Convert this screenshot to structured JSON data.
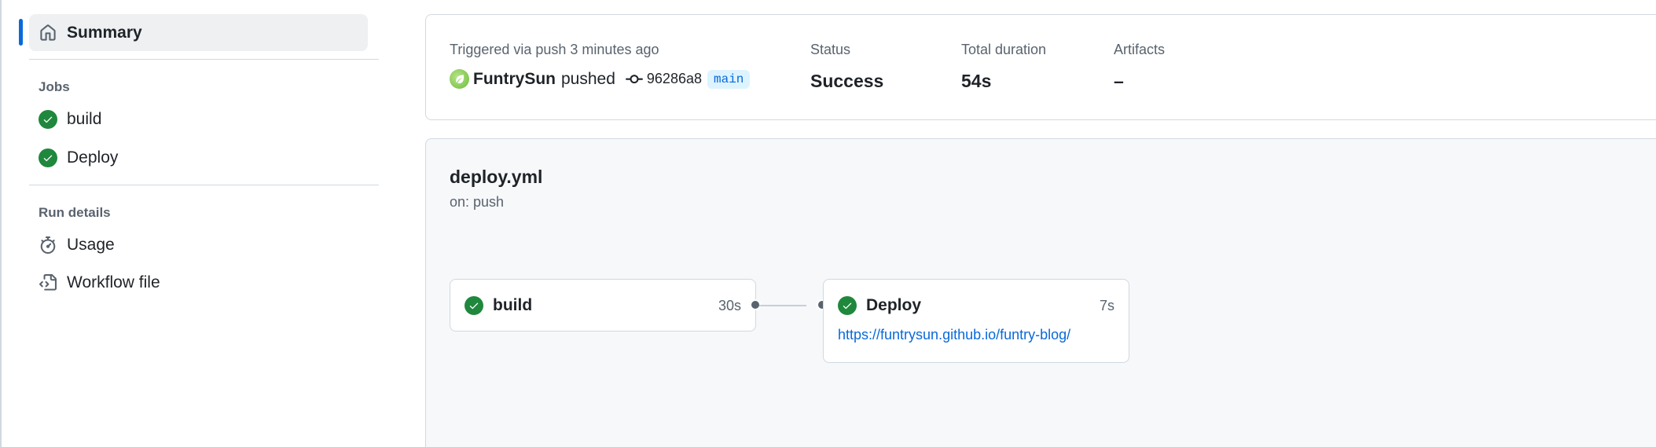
{
  "sidebar": {
    "summary_label": "Summary",
    "jobs_heading": "Jobs",
    "jobs": [
      {
        "label": "build",
        "icon": "check-circle-icon"
      },
      {
        "label": "Deploy",
        "icon": "check-circle-icon"
      }
    ],
    "run_details_heading": "Run details",
    "run_details": [
      {
        "label": "Usage",
        "icon": "stopwatch-icon"
      },
      {
        "label": "Workflow file",
        "icon": "file-code-icon"
      }
    ]
  },
  "summary": {
    "trigger_label": "Triggered via push 3 minutes ago",
    "actor": "FuntrySun",
    "action": "pushed",
    "commit_sha": "96286a8",
    "branch": "main",
    "status_label": "Status",
    "status_value": "Success",
    "duration_label": "Total duration",
    "duration_value": "54s",
    "artifacts_label": "Artifacts",
    "artifacts_value": "–"
  },
  "workflow": {
    "file_name": "deploy.yml",
    "trigger": "on: push",
    "jobs": [
      {
        "name": "build",
        "duration": "30s",
        "status": "success"
      },
      {
        "name": "Deploy",
        "duration": "7s",
        "status": "success",
        "url": "https://funtrysun.github.io/funtry-blog/"
      }
    ]
  },
  "colors": {
    "accent": "#0969da",
    "success": "#1f883d",
    "muted_text": "#59636e",
    "border": "#d1d9e0"
  }
}
